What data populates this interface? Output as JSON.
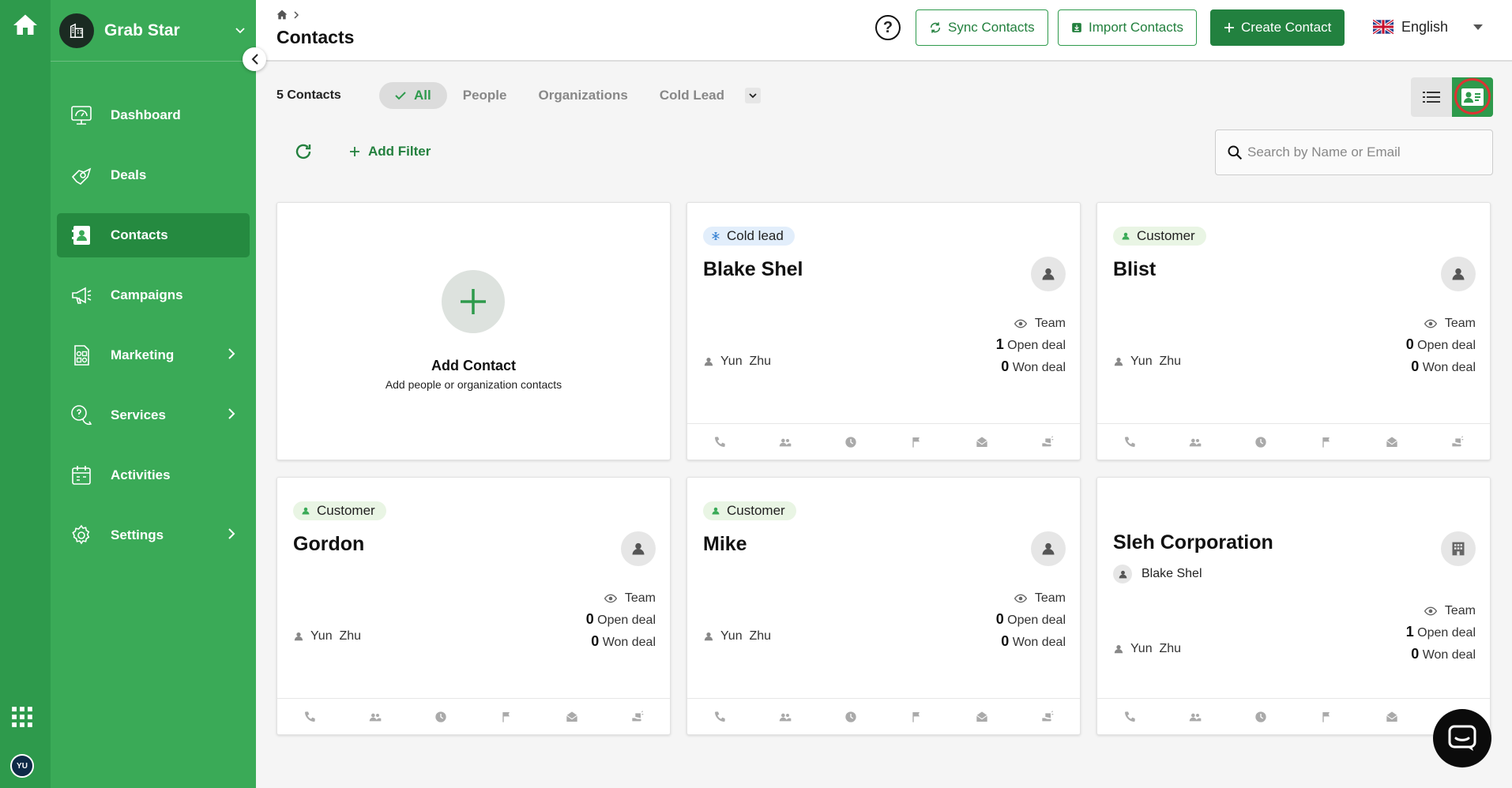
{
  "app": {
    "name": "Grab Star",
    "user_initials": "YU"
  },
  "sidebar": {
    "items": [
      {
        "label": "Dashboard",
        "icon": "dashboard-icon"
      },
      {
        "label": "Deals",
        "icon": "deals-icon"
      },
      {
        "label": "Contacts",
        "icon": "contacts-icon",
        "active": true
      },
      {
        "label": "Campaigns",
        "icon": "megaphone-icon"
      },
      {
        "label": "Marketing",
        "icon": "marketing-icon",
        "submenu": true
      },
      {
        "label": "Services",
        "icon": "services-icon",
        "submenu": true
      },
      {
        "label": "Activities",
        "icon": "calendar-icon"
      },
      {
        "label": "Settings",
        "icon": "gear-icon",
        "submenu": true
      }
    ]
  },
  "header": {
    "title": "Contacts",
    "sync_label": "Sync Contacts",
    "import_label": "Import Contacts",
    "create_label": "Create Contact",
    "language": "English"
  },
  "filters": {
    "count": "5 Contacts",
    "tabs": [
      "All",
      "People",
      "Organizations",
      "Cold Lead"
    ],
    "active_tab": "All",
    "add_filter": "Add Filter",
    "search_placeholder": "Search by Name or Email"
  },
  "add_card": {
    "title": "Add Contact",
    "subtitle": "Add people or organization contacts"
  },
  "cards": [
    {
      "tag": "Cold lead",
      "tag_type": "cold",
      "name": "Blake Shel",
      "type": "person",
      "visibility": "Team",
      "open_deals": "1",
      "open_label": "Open deal",
      "won_deals": "0",
      "won_label": "Won deal",
      "owner": "Yun  Zhu"
    },
    {
      "tag": "Customer",
      "tag_type": "cust",
      "name": "Blist",
      "type": "person",
      "visibility": "Team",
      "open_deals": "0",
      "open_label": "Open deal",
      "won_deals": "0",
      "won_label": "Won deal",
      "owner": "Yun  Zhu"
    },
    {
      "tag": "Customer",
      "tag_type": "cust",
      "name": "Gordon",
      "type": "person",
      "visibility": "Team",
      "open_deals": "0",
      "open_label": "Open deal",
      "won_deals": "0",
      "won_label": "Won deal",
      "owner": "Yun  Zhu"
    },
    {
      "tag": "Customer",
      "tag_type": "cust",
      "name": "Mike",
      "type": "person",
      "visibility": "Team",
      "open_deals": "0",
      "open_label": "Open deal",
      "won_deals": "0",
      "won_label": "Won deal",
      "owner": "Yun  Zhu"
    },
    {
      "tag": "",
      "tag_type": "",
      "name": "Sleh Corporation",
      "type": "organization",
      "contact_person": "Blake Shel",
      "visibility": "Team",
      "open_deals": "1",
      "open_label": "Open deal",
      "won_deals": "0",
      "won_label": "Won deal",
      "owner": "Yun  Zhu"
    }
  ],
  "colors": {
    "sidebar": "#3aaa57",
    "rail": "#2e9a4c",
    "accent": "#22813f",
    "highlight_ring": "#dd3333"
  }
}
